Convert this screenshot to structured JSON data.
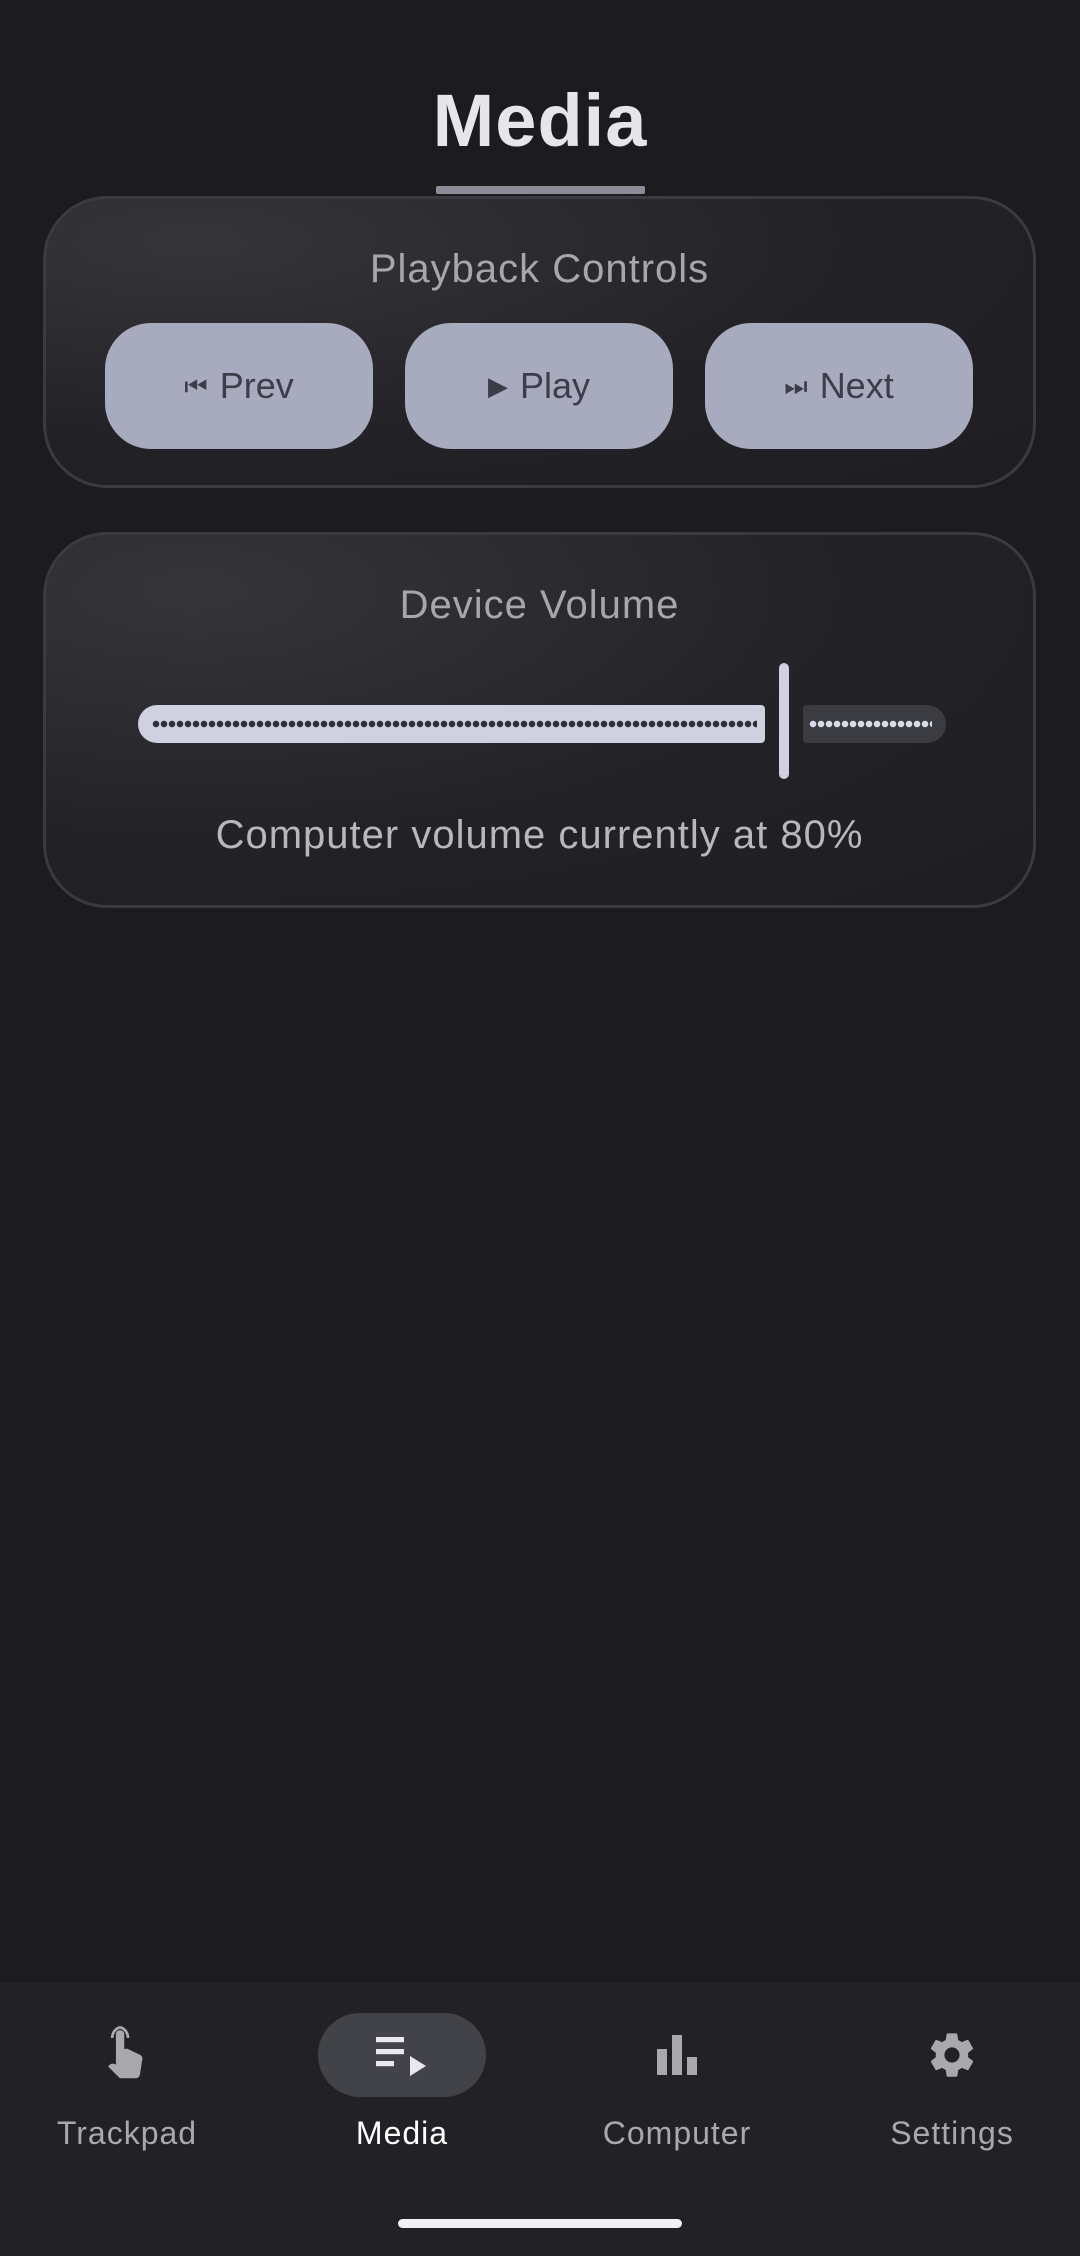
{
  "header": {
    "title": "Media"
  },
  "playback": {
    "title": "Playback Controls",
    "buttons": {
      "prev": {
        "icon": "previous-track-icon",
        "glyph": "⏮",
        "label": "Prev"
      },
      "play": {
        "icon": "play-icon",
        "glyph": "▶",
        "label": "Play"
      },
      "next": {
        "icon": "next-track-icon",
        "glyph": "⏭",
        "label": "Next"
      }
    }
  },
  "volume": {
    "title": "Device Volume",
    "value_percent": 80,
    "status": "Computer volume currently at 80%"
  },
  "bottom_nav": {
    "active": "Media",
    "items": [
      {
        "label": "Trackpad",
        "icon": "touch-hand-icon"
      },
      {
        "label": "Media",
        "icon": "playlist-play-icon"
      },
      {
        "label": "Computer",
        "icon": "bar-chart-icon"
      },
      {
        "label": "Settings",
        "icon": "gear-icon"
      }
    ]
  },
  "colors": {
    "background": "#1c1c1f",
    "button": "#a8aabe",
    "slider_active": "#cfd1e0",
    "nav_active_pill": "#424249"
  }
}
